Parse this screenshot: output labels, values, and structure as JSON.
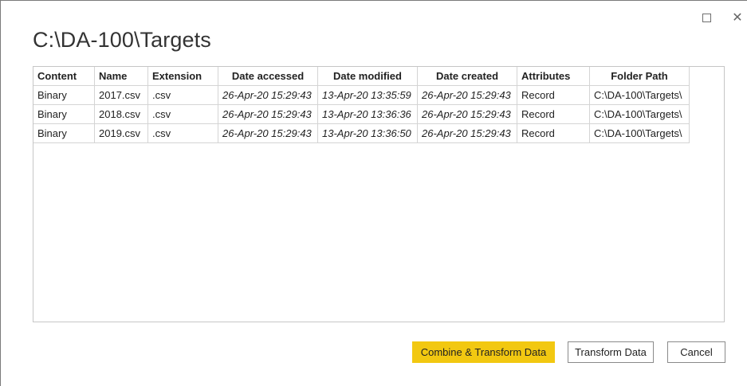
{
  "window": {
    "maximize_icon": "maximize-icon",
    "close_icon": "close-icon",
    "close_glyph": "✕"
  },
  "title": "C:\\DA-100\\Targets",
  "table": {
    "columns": [
      "Content",
      "Name",
      "Extension",
      "Date accessed",
      "Date modified",
      "Date created",
      "Attributes",
      "Folder Path"
    ],
    "rows": [
      [
        "Binary",
        "2017.csv",
        ".csv",
        "26-Apr-20 15:29:43",
        "13-Apr-20 13:35:59",
        "26-Apr-20 15:29:43",
        "Record",
        "C:\\DA-100\\Targets\\"
      ],
      [
        "Binary",
        "2018.csv",
        ".csv",
        "26-Apr-20 15:29:43",
        "13-Apr-20 13:36:36",
        "26-Apr-20 15:29:43",
        "Record",
        "C:\\DA-100\\Targets\\"
      ],
      [
        "Binary",
        "2019.csv",
        ".csv",
        "26-Apr-20 15:29:43",
        "13-Apr-20 13:36:50",
        "26-Apr-20 15:29:43",
        "Record",
        "C:\\DA-100\\Targets\\"
      ]
    ]
  },
  "buttons": {
    "combine_transform": "Combine & Transform Data",
    "transform": "Transform Data",
    "cancel": "Cancel"
  },
  "colors": {
    "primary_button": "#f2c811"
  }
}
